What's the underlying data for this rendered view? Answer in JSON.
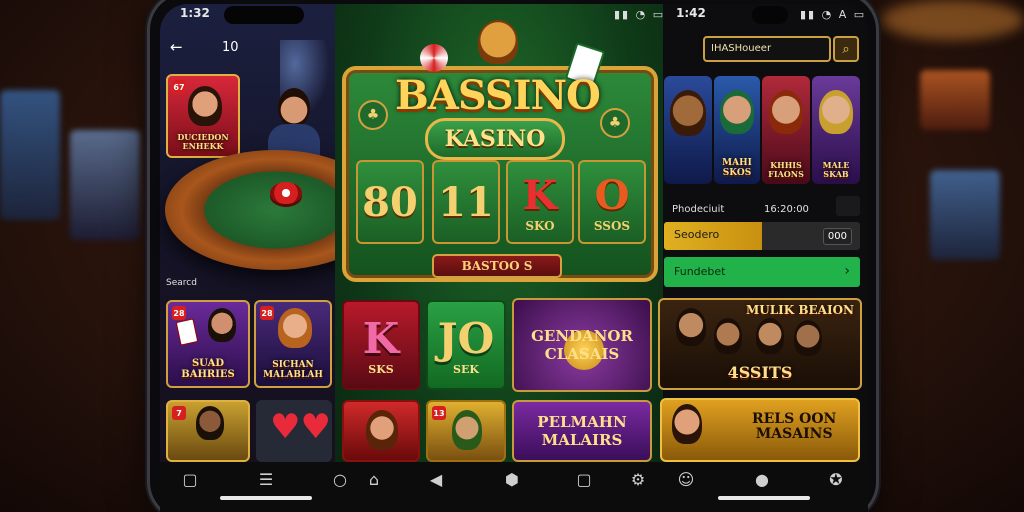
{
  "left_panel": {
    "status_time": "1:32",
    "nav_back": "←",
    "nav_label": "10",
    "featured_card": {
      "badge": "67",
      "title": "DUCIEDON\nENHEKK"
    },
    "section_label": "Searcd",
    "cards": [
      {
        "badge": "28",
        "title": "SUAD\nBAHRIES"
      },
      {
        "badge": "28",
        "title": "SICHAN\nMALABLAH"
      },
      {
        "badge": "7",
        "title": ""
      },
      {
        "badge": "",
        "title": ""
      }
    ]
  },
  "middle_panel": {
    "logo_title": "BASSINO",
    "logo_subtitle": "KASINO",
    "reels": [
      {
        "symbol": "80",
        "caption": ""
      },
      {
        "symbol": "11",
        "caption": ""
      },
      {
        "symbol": "K",
        "caption": "SKO"
      },
      {
        "symbol": "O",
        "caption": "SSOS"
      }
    ],
    "plaque": "BASTOO S",
    "tiles": [
      {
        "big": "K",
        "small": "SKS"
      },
      {
        "big": "JO",
        "small": "SEK"
      },
      {
        "big": "",
        "small": "GENDANOR\nCLASAIS"
      },
      {
        "big": "",
        "small": "PELMAHN\nMALAIRS"
      }
    ]
  },
  "right_panel": {
    "status_time": "1:42",
    "search_placeholder": "IHASHoueer",
    "row_left": "Phodeciuit",
    "row_right": "16:20:00",
    "gold_bar_label": "Seodero",
    "gold_bar_value": "000",
    "green_bar_label": "Fundebet",
    "game_titles": [
      "MAHI\nSKOS",
      "KHHIS\nFIAONS",
      "MALE\nSKAB"
    ],
    "promo_1": "MULIK BEAION",
    "promo_1_sub": "4SSITS",
    "promo_2": "RELS OON\nMASAINS"
  },
  "colors": {
    "gold": "#d9a43a",
    "green": "#22b24a",
    "felt": "#1f6a2a"
  }
}
